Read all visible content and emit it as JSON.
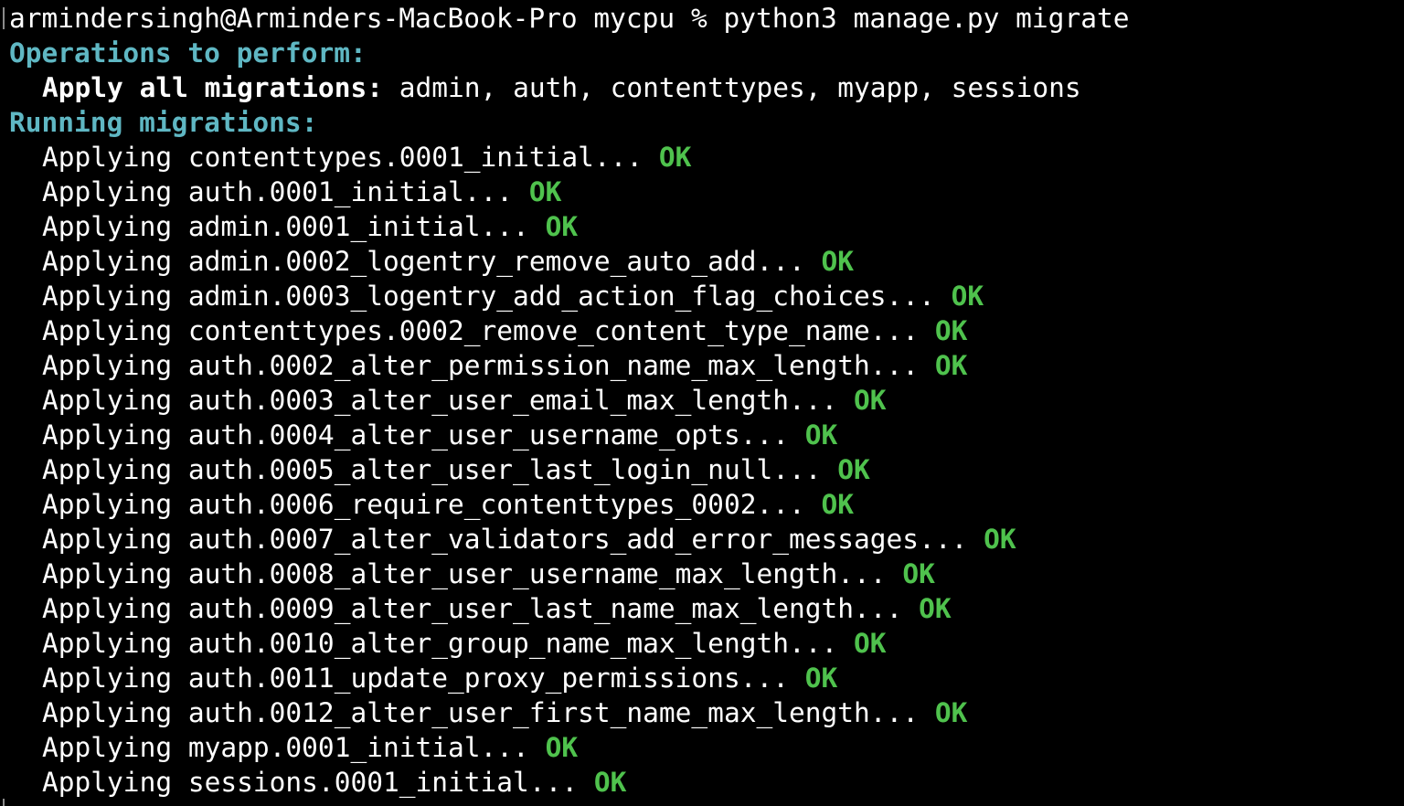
{
  "prompt": {
    "host": "armindersingh@Arminders-MacBook-Pro mycpu % ",
    "command": "python3 manage.py migrate"
  },
  "operations": {
    "heading": "Operations to perform:",
    "apply_label": "Apply all migrations:",
    "apply_value": " admin, auth, contenttypes, myapp, sessions"
  },
  "running": {
    "heading": "Running migrations:"
  },
  "migrations": [
    {
      "text": "Applying contenttypes.0001_initial... ",
      "status": "OK"
    },
    {
      "text": "Applying auth.0001_initial... ",
      "status": "OK"
    },
    {
      "text": "Applying admin.0001_initial... ",
      "status": "OK"
    },
    {
      "text": "Applying admin.0002_logentry_remove_auto_add... ",
      "status": "OK"
    },
    {
      "text": "Applying admin.0003_logentry_add_action_flag_choices... ",
      "status": "OK"
    },
    {
      "text": "Applying contenttypes.0002_remove_content_type_name... ",
      "status": "OK"
    },
    {
      "text": "Applying auth.0002_alter_permission_name_max_length... ",
      "status": "OK"
    },
    {
      "text": "Applying auth.0003_alter_user_email_max_length... ",
      "status": "OK"
    },
    {
      "text": "Applying auth.0004_alter_user_username_opts... ",
      "status": "OK"
    },
    {
      "text": "Applying auth.0005_alter_user_last_login_null... ",
      "status": "OK"
    },
    {
      "text": "Applying auth.0006_require_contenttypes_0002... ",
      "status": "OK"
    },
    {
      "text": "Applying auth.0007_alter_validators_add_error_messages... ",
      "status": "OK"
    },
    {
      "text": "Applying auth.0008_alter_user_username_max_length... ",
      "status": "OK"
    },
    {
      "text": "Applying auth.0009_alter_user_last_name_max_length... ",
      "status": "OK"
    },
    {
      "text": "Applying auth.0010_alter_group_name_max_length... ",
      "status": "OK"
    },
    {
      "text": "Applying auth.0011_update_proxy_permissions... ",
      "status": "OK"
    },
    {
      "text": "Applying auth.0012_alter_user_first_name_max_length... ",
      "status": "OK"
    },
    {
      "text": "Applying myapp.0001_initial... ",
      "status": "OK"
    },
    {
      "text": "Applying sessions.0001_initial... ",
      "status": "OK"
    }
  ],
  "colors": {
    "background": "#000000",
    "text": "#ffffff",
    "heading": "#5fb7c3",
    "ok": "#4fc24d"
  }
}
